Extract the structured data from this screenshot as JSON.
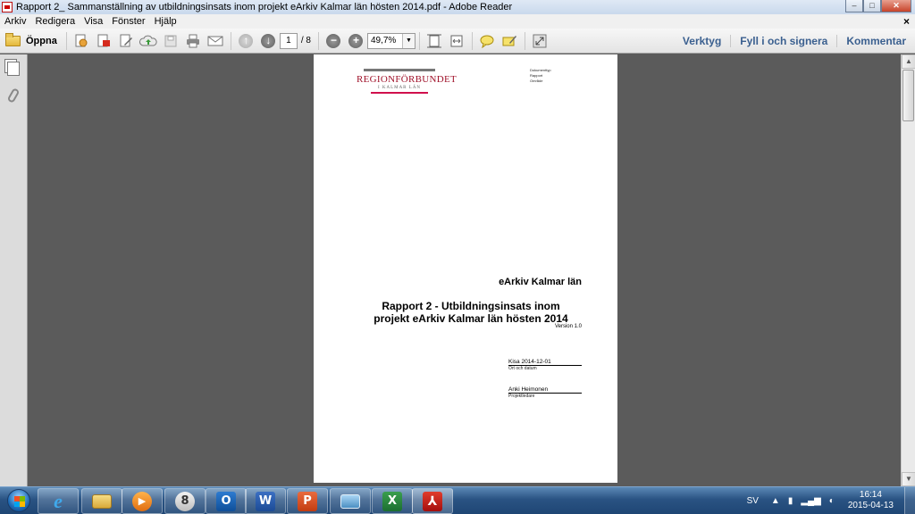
{
  "window": {
    "title": "Rapport 2_ Sammanställning av utbildningsinsats inom projekt eArkiv Kalmar län hösten 2014.pdf - Adobe Reader",
    "minimize": "–",
    "maximize": "□",
    "close": "✕"
  },
  "menu": {
    "items": [
      "Arkiv",
      "Redigera",
      "Visa",
      "Fönster",
      "Hjälp"
    ],
    "close": "×"
  },
  "toolbar": {
    "open_label": "Öppna",
    "page_current": "1",
    "page_total": "/ 8",
    "zoom": "49,7%",
    "right_links": [
      "Verktyg",
      "Fyll i och signera",
      "Kommentar"
    ]
  },
  "document": {
    "logo": {
      "main_part1": "REGION",
      "main_part2": "FÖRBUNDET",
      "sub": "I KALMAR LÄN"
    },
    "meta_lines": [
      "Dokumenttyp",
      "Rapport",
      "Område"
    ],
    "project": "eArkiv Kalmar län",
    "title_line1": "Rapport 2 - Utbildningsinsats inom",
    "title_line2": "projekt eArkiv Kalmar län hösten 2014",
    "version": "Version 1.0",
    "place_date": "Kisa 2014-12-01",
    "place_date_label": "Ort och datum",
    "signer": "Anki Heimonen",
    "signer_role": "Projektledare"
  },
  "taskbar": {
    "apps": [
      {
        "name": "internet-explorer",
        "glyph": "e"
      },
      {
        "name": "windows-explorer",
        "glyph": ""
      },
      {
        "name": "media-player",
        "glyph": "▶"
      },
      {
        "name": "keepass",
        "glyph": "8"
      },
      {
        "name": "outlook",
        "glyph": "O"
      },
      {
        "name": "word",
        "glyph": "W"
      },
      {
        "name": "powerpoint",
        "glyph": "P"
      },
      {
        "name": "photo-viewer",
        "glyph": ""
      },
      {
        "name": "excel",
        "glyph": "X"
      },
      {
        "name": "adobe-reader",
        "glyph": "⅄"
      }
    ],
    "language": "SV",
    "time": "16:14",
    "date": "2015-04-13"
  }
}
